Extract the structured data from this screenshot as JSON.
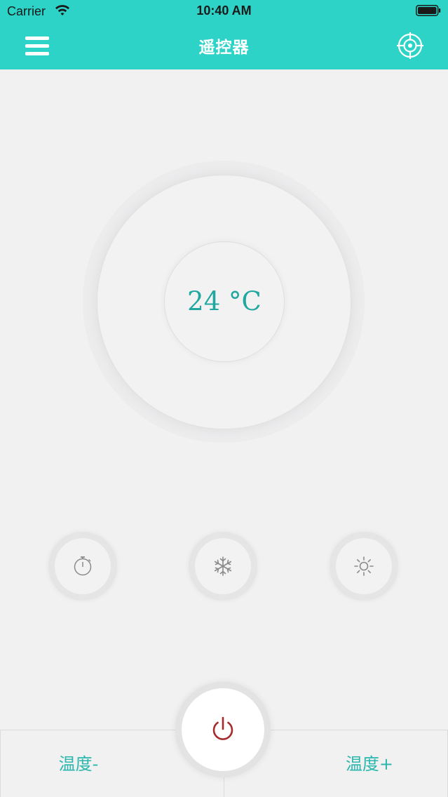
{
  "status_bar": {
    "carrier": "Carrier",
    "time": "10:40 AM"
  },
  "header": {
    "title": "遥控器",
    "menu_icon": "menu-icon",
    "action_icon": "crosshair-target-icon",
    "background_color": "#2dd3c6"
  },
  "dial": {
    "temperature": "24 °C",
    "accent_color": "#20a79f"
  },
  "modes": [
    {
      "name": "timer",
      "icon": "timer-icon"
    },
    {
      "name": "cool",
      "icon": "snowflake-icon"
    },
    {
      "name": "heat",
      "icon": "sun-icon"
    }
  ],
  "bottom": {
    "temp_down_label": "温度-",
    "temp_up_label": "温度+",
    "power_icon": "power-icon",
    "power_color": "#a62a2a",
    "label_color": "#2bb7ad"
  }
}
